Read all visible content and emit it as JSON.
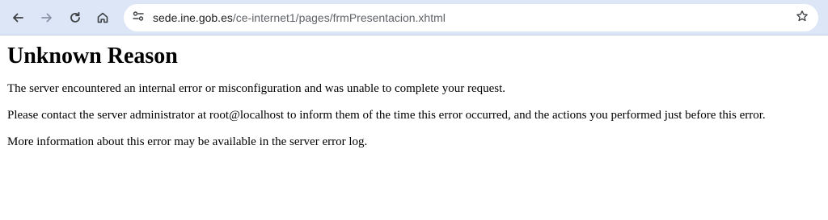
{
  "browser": {
    "url_domain": "sede.ine.gob.es",
    "url_path": "/ce-internet1/pages/frmPresentacion.xhtml",
    "icons": {
      "back": "arrow-left-icon",
      "forward": "arrow-right-icon",
      "reload": "reload-icon",
      "home": "home-icon",
      "site_info": "tune-icon",
      "bookmark": "star-icon"
    }
  },
  "page": {
    "heading": "Unknown Reason",
    "paragraphs": [
      "The server encountered an internal error or misconfiguration and was unable to complete your request.",
      "Please contact the server administrator at root@localhost to inform them of the time this error occurred, and the actions you performed just before this error.",
      "More information about this error may be available in the server error log."
    ]
  },
  "colors": {
    "toolbar_bg": "#dce6f7",
    "icon": "#3c4043",
    "icon_disabled": "#8a94a6"
  }
}
